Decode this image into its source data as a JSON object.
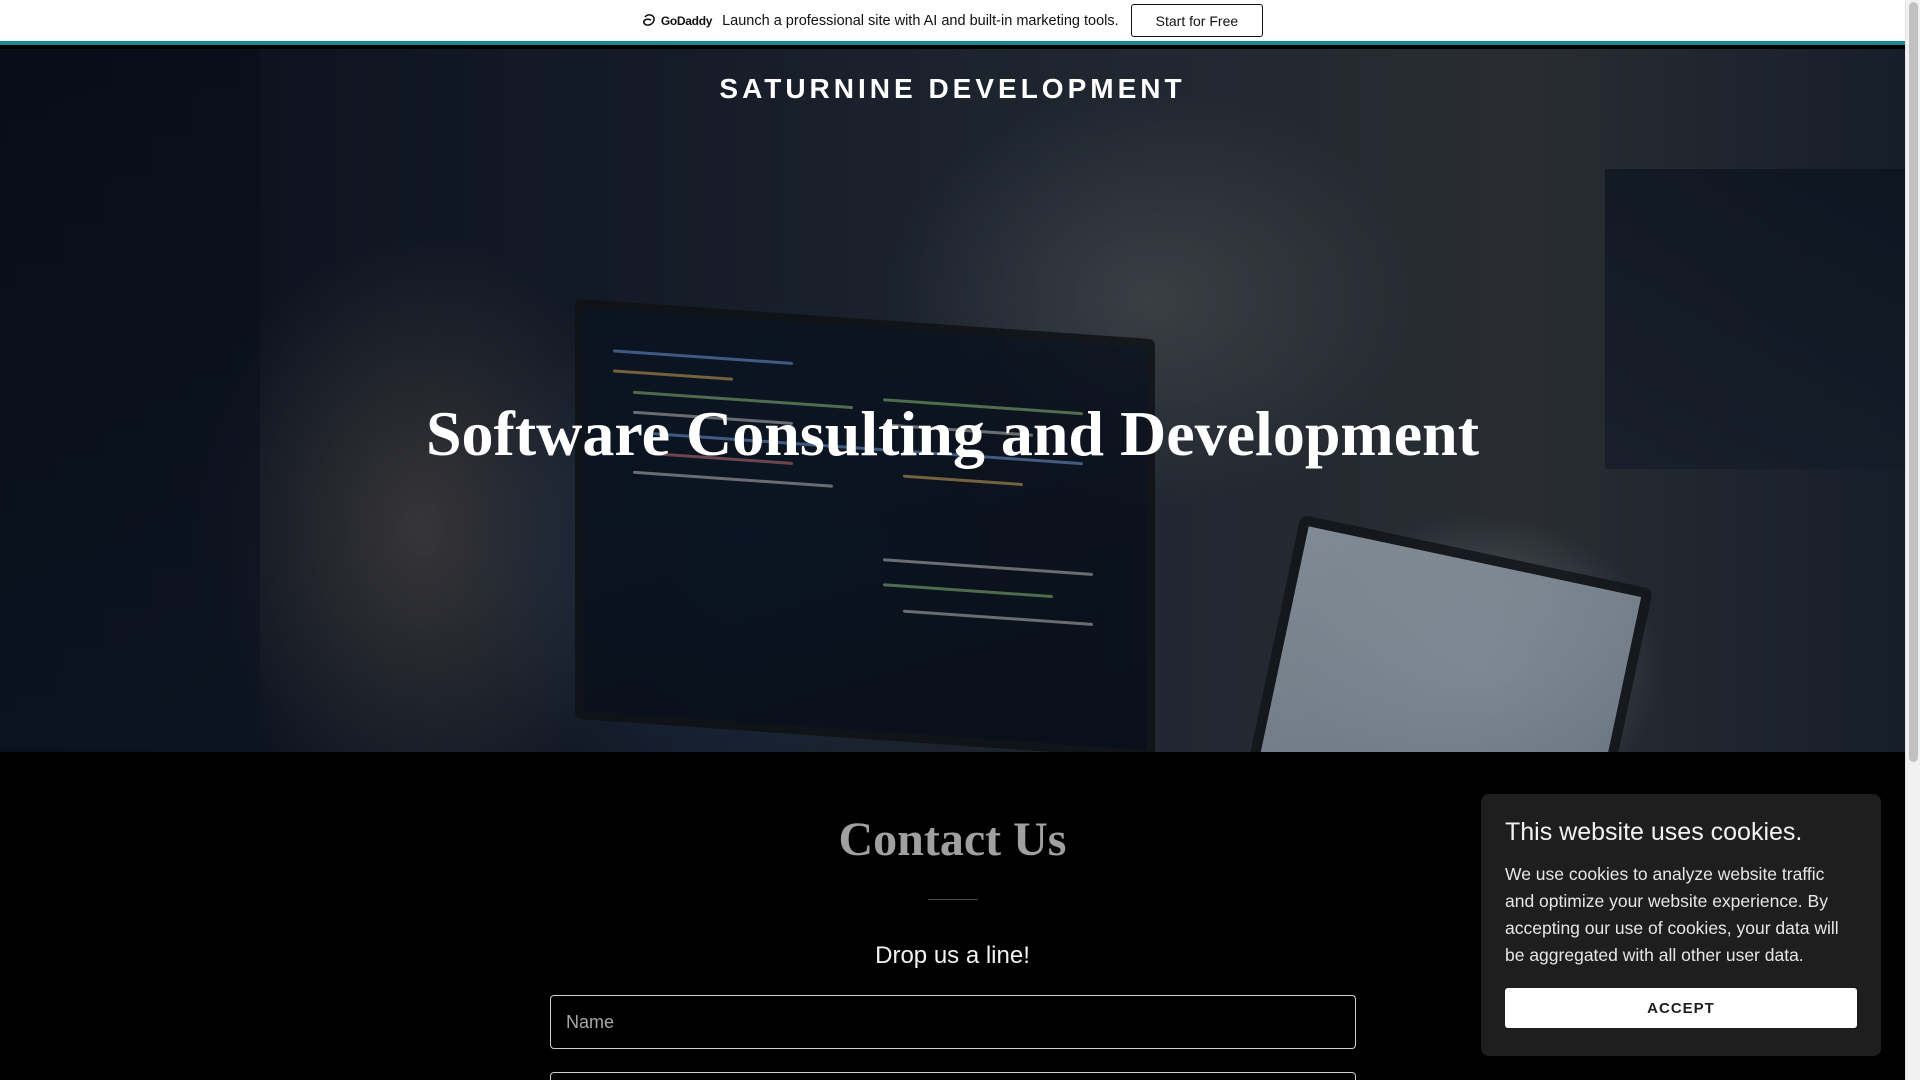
{
  "promo": {
    "logo_text": "GoDaddy",
    "message": "Launch a professional site with AI and built-in marketing tools.",
    "cta_label": "Start for Free"
  },
  "hero": {
    "site_title": "SATURNINE DEVELOPMENT",
    "heading": "Software Consulting and Development"
  },
  "contact": {
    "title": "Contact Us",
    "subtitle": "Drop us a line!",
    "name_placeholder": "Name",
    "email_placeholder": ""
  },
  "cookie": {
    "title": "This website uses cookies.",
    "body": "We use cookies to analyze website traffic and optimize your website experience. By accepting our use of cookies, your data will be aggregated with all other user data.",
    "accept_label": "ACCEPT"
  },
  "colors": {
    "accent_bar": "#1b8a93",
    "cookie_bg": "#1e1e1e",
    "contact_title": "#a0a0a0"
  }
}
